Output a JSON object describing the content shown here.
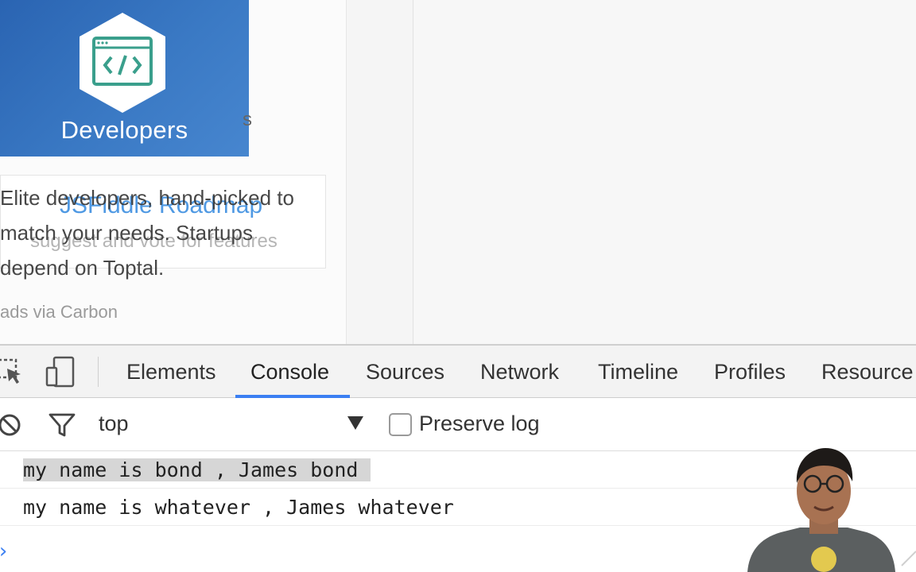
{
  "ad": {
    "image_caption": "Developers",
    "cut_letter": "s",
    "lines": [
      "Elite developers, hand-picked to",
      "match your needs. Startups",
      "depend on Toptal."
    ],
    "attribution": "ads via Carbon"
  },
  "roadmap": {
    "title": "JSFiddle Roadmap",
    "subtitle": "suggest and vote for features"
  },
  "devtools": {
    "tabs": [
      {
        "label": "Elements"
      },
      {
        "label": "Console"
      },
      {
        "label": "Sources"
      },
      {
        "label": "Network"
      },
      {
        "label": "Timeline"
      },
      {
        "label": "Profiles"
      },
      {
        "label": "Resource"
      }
    ],
    "active_tab": "Console",
    "context": "top",
    "preserve_log_label": "Preserve log",
    "preserve_log_checked": false,
    "accent_color": "#3b7ff2"
  },
  "console": {
    "messages": [
      "my name is bond , James bond",
      "my name is whatever , James whatever"
    ],
    "prompt_symbol": "›"
  },
  "icons": {
    "inspect": "inspect-element-icon",
    "device": "device-mode-icon",
    "clear": "clear-console-icon",
    "filter": "filter-icon",
    "select": "dropdown-arrow-icon",
    "ad_logo": "code-window-icon"
  }
}
